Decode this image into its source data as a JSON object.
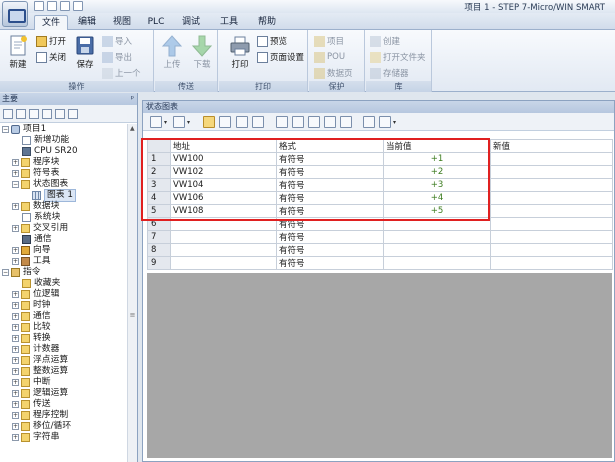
{
  "window": {
    "title": "项目 1 - STEP 7-Micro/WIN SMART"
  },
  "menu_tabs": [
    "文件",
    "编辑",
    "视图",
    "PLC",
    "调试",
    "工具",
    "帮助"
  ],
  "active_tab": "文件",
  "ribbon": {
    "groups": {
      "operations": "操作",
      "transfer": "传送",
      "print": "打印",
      "protect": "保护",
      "library": "库"
    },
    "new": "新建",
    "open": "打开",
    "close": "关闭",
    "save": "保存",
    "import": "导入",
    "export": "导出",
    "previous": "上一个",
    "upload": "上传",
    "download": "下载",
    "print": "打印",
    "preview": "预览",
    "page_setup": "页面设置",
    "project": "项目",
    "pou": "POU",
    "data_page": "数据页",
    "create": "创建",
    "open_folder": "打开文件夹",
    "memory": "存储器"
  },
  "left_panel": {
    "title": "主要",
    "tree": [
      {
        "label": "项目1",
        "icon": "project-icon"
      },
      {
        "label": "新增功能",
        "icon": "new-features-icon"
      },
      {
        "label": "CPU SR20",
        "icon": "cpu-icon"
      },
      {
        "label": "程序块",
        "icon": "folder-icon"
      },
      {
        "label": "符号表",
        "icon": "folder-icon"
      },
      {
        "label": "状态图表",
        "icon": "folder-icon"
      },
      {
        "label": "图表 1",
        "icon": "chart-icon"
      },
      {
        "label": "数据块",
        "icon": "folder-icon"
      },
      {
        "label": "系统块",
        "icon": "system-block-icon"
      },
      {
        "label": "交叉引用",
        "icon": "folder-icon"
      },
      {
        "label": "通信",
        "icon": "communication-icon"
      },
      {
        "label": "向导",
        "icon": "wizard-icon"
      },
      {
        "label": "工具",
        "icon": "tools-icon"
      },
      {
        "label": "指令",
        "icon": "instructions-icon"
      },
      {
        "label": "收藏夹",
        "icon": "folder-icon"
      },
      {
        "label": "位逻辑",
        "icon": "folder-icon"
      },
      {
        "label": "时钟",
        "icon": "clock-icon"
      },
      {
        "label": "通信",
        "icon": "folder-icon"
      },
      {
        "label": "比较",
        "icon": "folder-icon"
      },
      {
        "label": "转换",
        "icon": "folder-icon"
      },
      {
        "label": "计数器",
        "icon": "folder-icon"
      },
      {
        "label": "浮点运算",
        "icon": "folder-icon"
      },
      {
        "label": "整数运算",
        "icon": "folder-icon"
      },
      {
        "label": "中断",
        "icon": "folder-icon"
      },
      {
        "label": "逻辑运算",
        "icon": "folder-icon"
      },
      {
        "label": "传送",
        "icon": "folder-icon"
      },
      {
        "label": "程序控制",
        "icon": "folder-icon"
      },
      {
        "label": "移位/循环",
        "icon": "folder-icon"
      },
      {
        "label": "字符串",
        "icon": "folder-icon"
      }
    ]
  },
  "status_chart": {
    "title": "状态图表",
    "columns": [
      "地址",
      "格式",
      "当前值",
      "新值"
    ],
    "rows": [
      {
        "n": "1",
        "address": "VW100",
        "format": "有符号",
        "current": "+1",
        "new": ""
      },
      {
        "n": "2",
        "address": "VW102",
        "format": "有符号",
        "current": "+2",
        "new": ""
      },
      {
        "n": "3",
        "address": "VW104",
        "format": "有符号",
        "current": "+3",
        "new": ""
      },
      {
        "n": "4",
        "address": "VW106",
        "format": "有符号",
        "current": "+4",
        "new": ""
      },
      {
        "n": "5",
        "address": "VW108",
        "format": "有符号",
        "current": "+5",
        "new": ""
      },
      {
        "n": "6",
        "address": "",
        "format": "有符号",
        "current": "",
        "new": ""
      },
      {
        "n": "7",
        "address": "",
        "format": "有符号",
        "current": "",
        "new": ""
      },
      {
        "n": "8",
        "address": "",
        "format": "有符号",
        "current": "",
        "new": ""
      },
      {
        "n": "9",
        "address": "",
        "format": "有符号",
        "current": "",
        "new": ""
      }
    ]
  },
  "colors": {
    "highlight": "#e02020",
    "current_value": "#3c7c1f",
    "accent": "#f5d77b"
  }
}
